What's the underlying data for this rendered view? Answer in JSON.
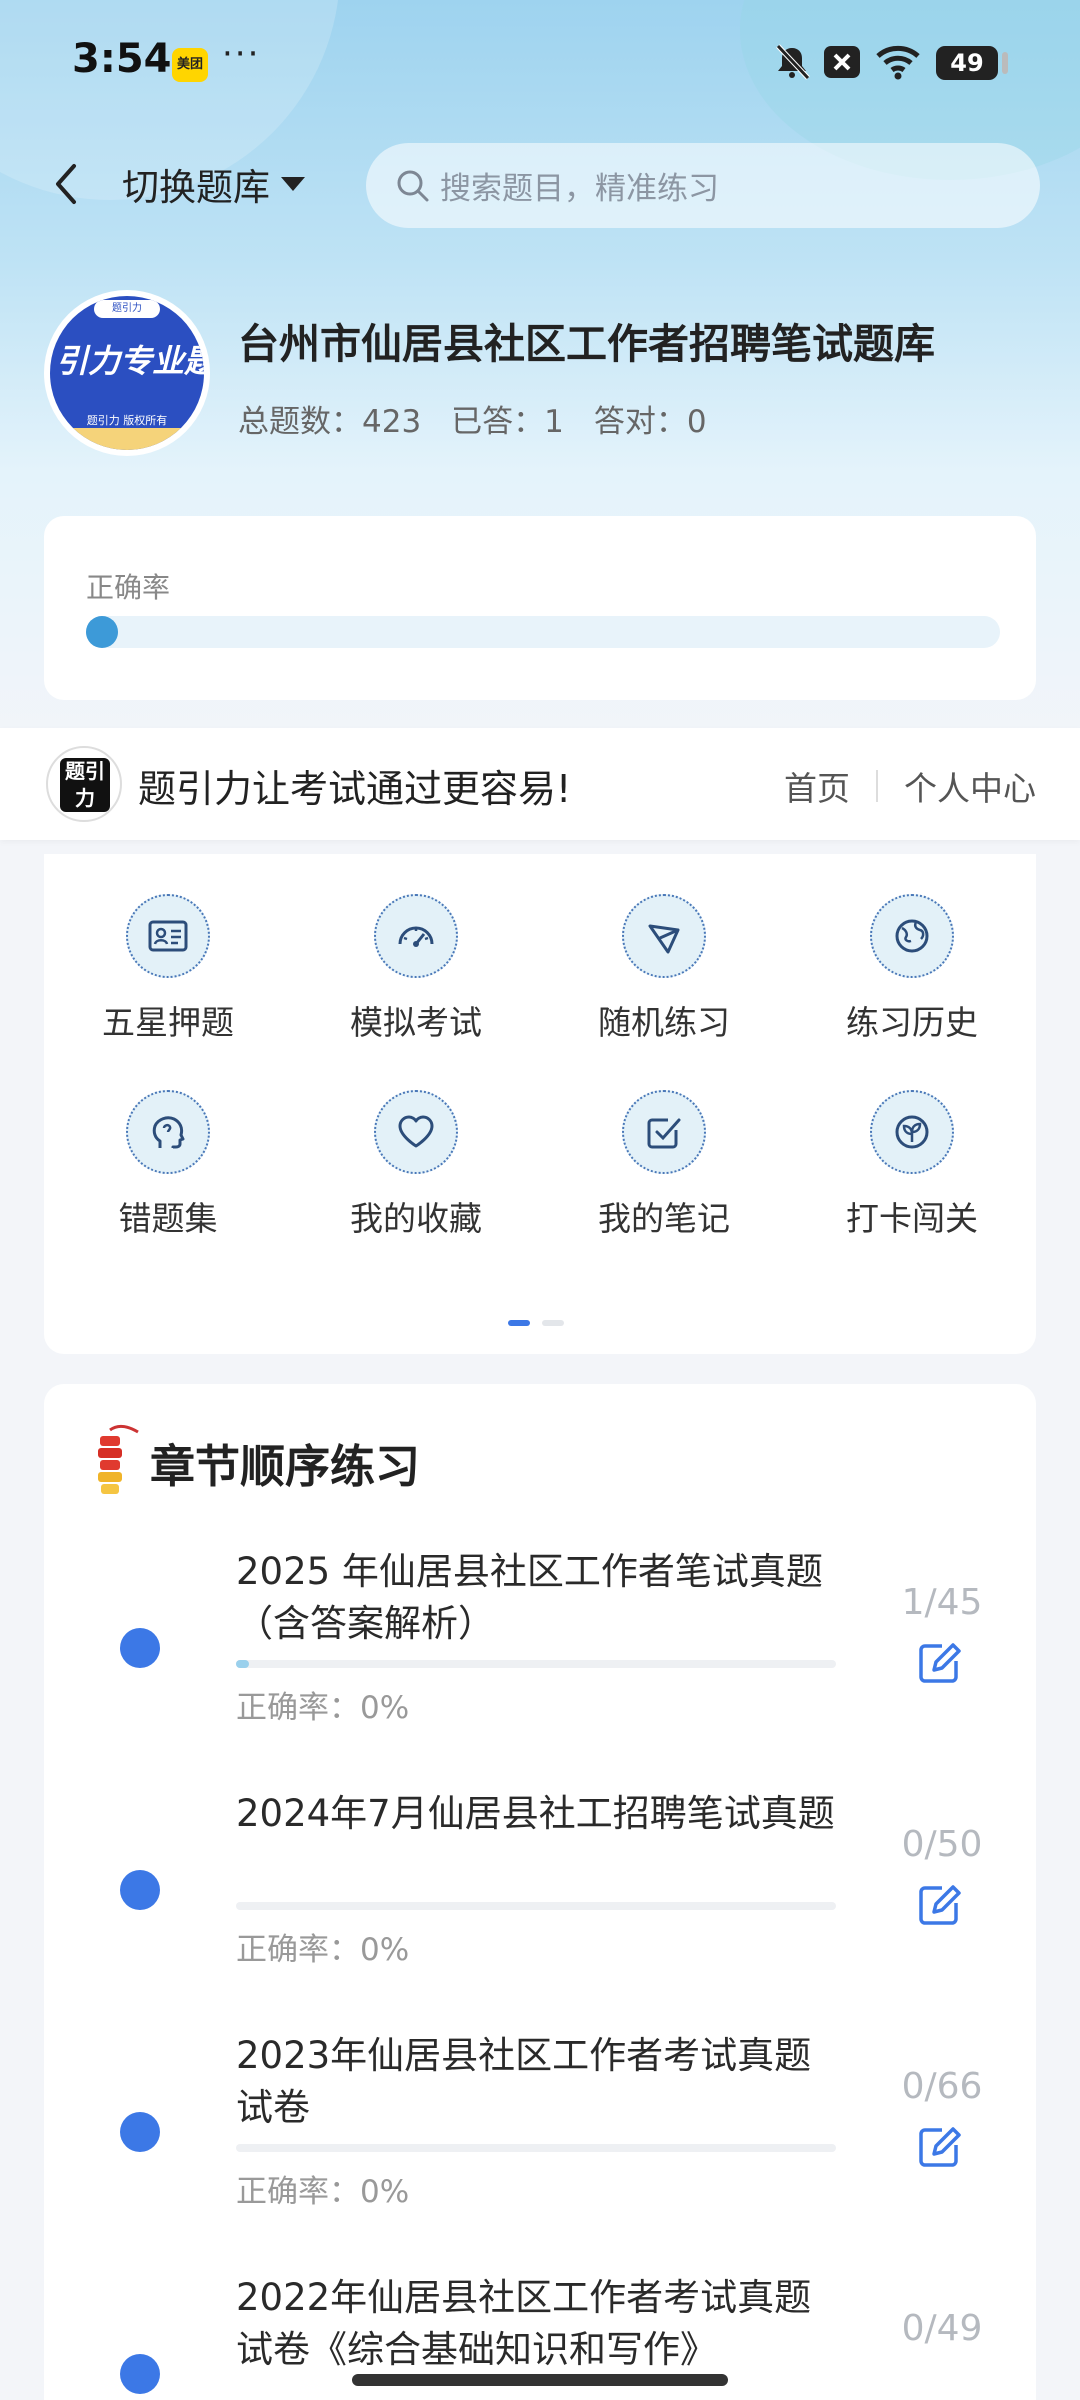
{
  "status_bar": {
    "time": "3:54",
    "app_badge": "美团",
    "more": "···",
    "battery": "49"
  },
  "header": {
    "switch_label": "切换题库",
    "search_placeholder": "搜索题目，精准练习"
  },
  "bank": {
    "logo_top": "题引力",
    "logo_text": "引力专业题",
    "logo_sub": "题引力 版权所有",
    "title": "台州市仙居县社区工作者招聘笔试题库",
    "stats": {
      "total": "总题数：423",
      "answered": "已答：1",
      "correct": "答对：0"
    }
  },
  "accuracy": {
    "label": "正确率",
    "value": 0.0
  },
  "promo": {
    "logo": "题引力",
    "text": "题引力让考试通过更容易!",
    "nav_home": "首页",
    "nav_profile": "个人中心"
  },
  "features": [
    {
      "label": "五星押题",
      "icon": "id-card-icon"
    },
    {
      "label": "模拟考试",
      "icon": "speedometer-icon"
    },
    {
      "label": "随机练习",
      "icon": "network-icon"
    },
    {
      "label": "练习历史",
      "icon": "globe-icon"
    },
    {
      "label": "错题集",
      "icon": "head-icon"
    },
    {
      "label": "我的收藏",
      "icon": "heart-icon"
    },
    {
      "label": "我的笔记",
      "icon": "checkbox-icon"
    },
    {
      "label": "打卡闯关",
      "icon": "sprout-icon"
    }
  ],
  "pager": {
    "pages": 2,
    "active": 0
  },
  "chapters": {
    "heading": "章节顺序练习",
    "items": [
      {
        "title": "2025 年仙居县社区工作者笔试真题（含答案解析）",
        "rate": "正确率：0%",
        "count": "1/45",
        "progress": 0.022
      },
      {
        "title": "2024年7月仙居县社工招聘笔试真题",
        "rate": "正确率：0%",
        "count": "0/50",
        "progress": 0
      },
      {
        "title": "2023年仙居县社区工作者考试真题试卷",
        "rate": "正确率：0%",
        "count": "0/66",
        "progress": 0
      },
      {
        "title": "2022年仙居县社区工作者考试真题试卷《综合基础知识和写作》",
        "rate": "",
        "count": "0/49",
        "progress": 0
      }
    ]
  },
  "colors": {
    "accent": "#3c78e6",
    "progress": "#3d9ad8",
    "logo_bg": "#2b4fc1"
  }
}
